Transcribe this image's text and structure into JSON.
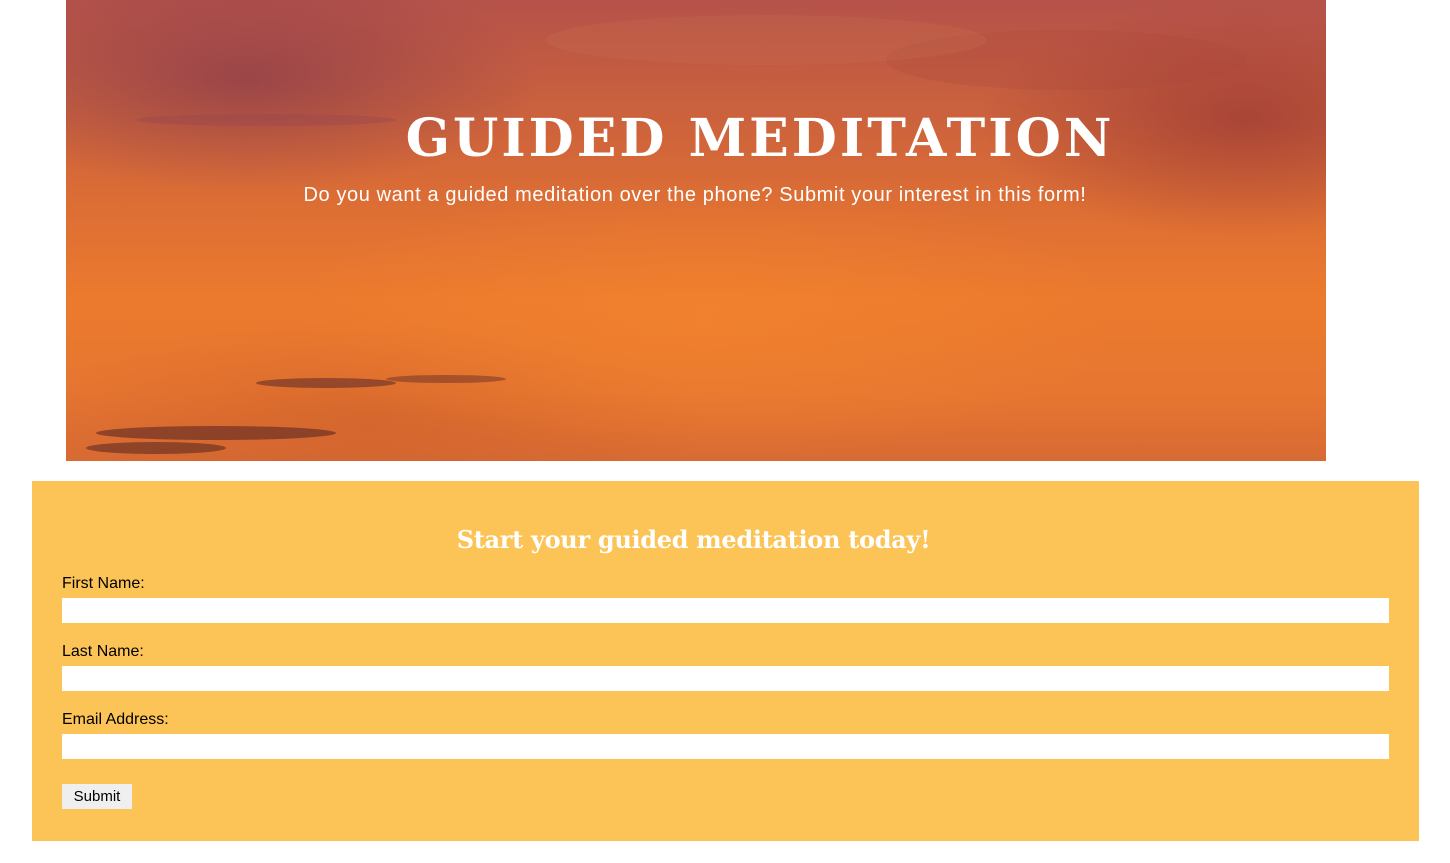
{
  "hero": {
    "title": "GUIDED MEDITATION",
    "subtitle": "Do you want a guided meditation over the phone? Submit your interest in this form!"
  },
  "form": {
    "heading": "Start your guided meditation today!",
    "fields": [
      {
        "label": "First Name:",
        "value": ""
      },
      {
        "label": "Last Name:",
        "value": ""
      },
      {
        "label": "Email Address:",
        "value": ""
      }
    ],
    "submit_label": "Submit"
  },
  "colors": {
    "panel_background": "#fcc457",
    "hero_sky": "#e67630",
    "heading_text": "#ffffff"
  }
}
